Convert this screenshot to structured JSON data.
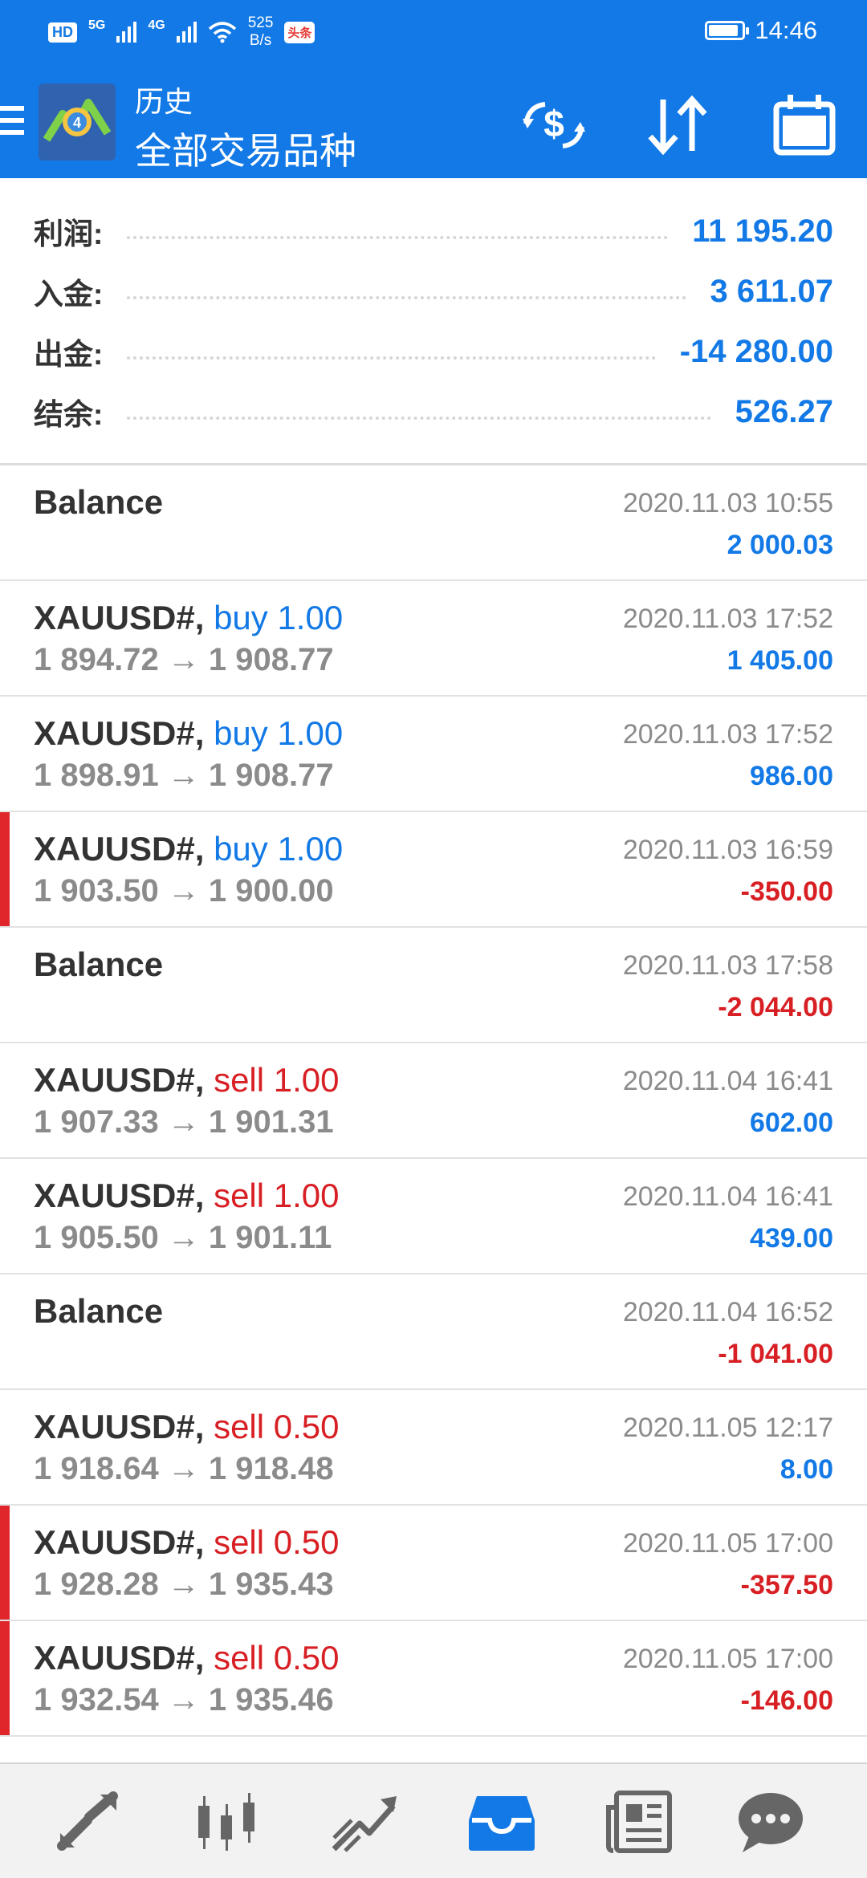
{
  "status_bar": {
    "hd": "HD",
    "net1": "5G",
    "net2": "4G",
    "speed_value": "525",
    "speed_unit": "B/s",
    "news_badge": "头条",
    "time": "14:46"
  },
  "app_bar": {
    "title": "历史",
    "subtitle": "全部交易品种"
  },
  "summary": {
    "rows": [
      {
        "label": "利润:",
        "value": "11 195.20"
      },
      {
        "label": "入金:",
        "value": "3 611.07"
      },
      {
        "label": "出金:",
        "value": "-14 280.00"
      },
      {
        "label": "结余:",
        "value": "526.27"
      }
    ]
  },
  "history": [
    {
      "symbol": "Balance",
      "side": "",
      "prices": "",
      "date": "2020.11.03 10:55",
      "profit": "2 000.03"
    },
    {
      "symbol": "XAUUSD#,",
      "side": "buy 1.00",
      "prices": "1 894.72 → 1 908.77",
      "date": "2020.11.03 17:52",
      "profit": "1 405.00"
    },
    {
      "symbol": "XAUUSD#,",
      "side": "buy 1.00",
      "prices": "1 898.91 → 1 908.77",
      "date": "2020.11.03 17:52",
      "profit": "986.00"
    },
    {
      "symbol": "XAUUSD#,",
      "side": "buy 1.00",
      "prices": "1 903.50 → 1 900.00",
      "date": "2020.11.03 16:59",
      "profit": "-350.00"
    },
    {
      "symbol": "Balance",
      "side": "",
      "prices": "",
      "date": "2020.11.03 17:58",
      "profit": "-2 044.00"
    },
    {
      "symbol": "XAUUSD#,",
      "side": "sell 1.00",
      "prices": "1 907.33 → 1 901.31",
      "date": "2020.11.04 16:41",
      "profit": "602.00"
    },
    {
      "symbol": "XAUUSD#,",
      "side": "sell 1.00",
      "prices": "1 905.50 → 1 901.11",
      "date": "2020.11.04 16:41",
      "profit": "439.00"
    },
    {
      "symbol": "Balance",
      "side": "",
      "prices": "",
      "date": "2020.11.04 16:52",
      "profit": "-1 041.00"
    },
    {
      "symbol": "XAUUSD#,",
      "side": "sell 0.50",
      "prices": "1 918.64 → 1 918.48",
      "date": "2020.11.05 12:17",
      "profit": "8.00"
    },
    {
      "symbol": "XAUUSD#,",
      "side": "sell 0.50",
      "prices": "1 928.28 → 1 935.43",
      "date": "2020.11.05 17:00",
      "profit": "-357.50"
    },
    {
      "symbol": "XAUUSD#,",
      "side": "sell 0.50",
      "prices": "1 932.54 → 1 935.46",
      "date": "2020.11.05 17:00",
      "profit": "-146.00"
    }
  ],
  "colors": {
    "brand_blue": "#1279e6",
    "profit_blue": "#1279e6",
    "loss_red": "#d71f24",
    "loss_marker": "#e0262b"
  },
  "icons": {
    "toolbar": [
      "currency-swap-icon",
      "sort-icon",
      "calendar-icon"
    ],
    "bottom_nav": [
      "quotes-icon",
      "chart-icon",
      "trade-icon",
      "history-icon",
      "news-icon",
      "chat-icon"
    ]
  }
}
